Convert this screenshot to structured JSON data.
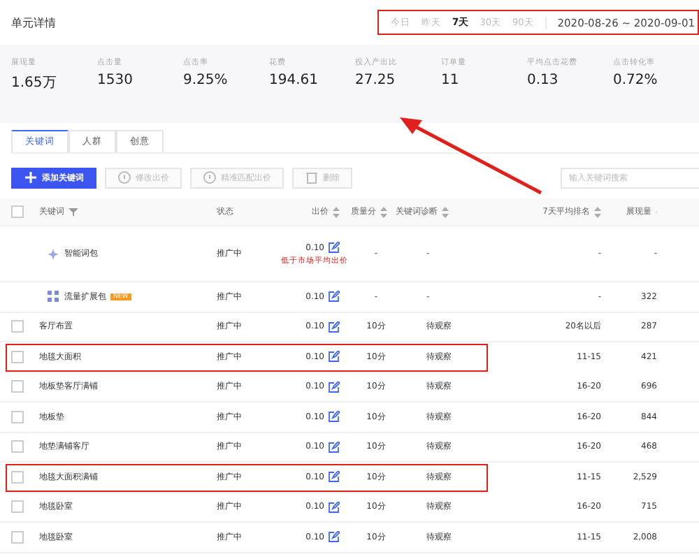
{
  "title": "单元详情",
  "date_filter": {
    "highlighted": true,
    "ranges": [
      {
        "label": "今日",
        "selected": false
      },
      {
        "label": "昨天",
        "selected": false
      },
      {
        "label": "7天",
        "selected": true
      },
      {
        "label": "30天",
        "selected": false
      },
      {
        "label": "90天",
        "selected": false
      }
    ],
    "date_range": "2020-08-26 ~ 2020-09-01"
  },
  "metrics": [
    {
      "label": "展现量",
      "value": "1.65万"
    },
    {
      "label": "点击量",
      "value": "1530"
    },
    {
      "label": "点击率",
      "value": "9.25%"
    },
    {
      "label": "花费",
      "value": "194.61"
    },
    {
      "label": "投入产出比",
      "value": "27.25"
    },
    {
      "label": "订单量",
      "value": "11"
    },
    {
      "label": "平均点击花费",
      "value": "0.13"
    },
    {
      "label": "点击转化率",
      "value": "0.72%"
    }
  ],
  "tabs": [
    {
      "label": "关键词",
      "selected": true
    },
    {
      "label": "人群",
      "selected": false
    },
    {
      "label": "创意",
      "selected": false
    }
  ],
  "toolbar": {
    "buttons": [
      {
        "label": "添加关键词",
        "kind": "add",
        "disabled": false
      },
      {
        "label": "修改出价",
        "kind": "edit",
        "disabled": true
      },
      {
        "label": "精准匹配出价",
        "kind": "edit",
        "disabled": true
      },
      {
        "label": "删除",
        "kind": "delete",
        "disabled": true
      }
    ],
    "search": {
      "placeholder": "输入关键词搜索"
    }
  },
  "table": {
    "select_all_checked": false,
    "columns": [
      "关键词",
      "状态",
      "出价",
      "质量分",
      "关键词诊断",
      "7天平均排名",
      "展现量"
    ],
    "rows": [
      {
        "kind": "package",
        "keyword": "智能词包",
        "status": "推广中",
        "bid": "0.10",
        "bid_note": "低于市场平均出价",
        "quality": "-",
        "diagnosis": "-",
        "rank": "-",
        "impressions": "-",
        "highlighted": false
      },
      {
        "kind": "package",
        "keyword": "流量扩展包",
        "badge": "NEW",
        "status": "推广中",
        "bid": "0.10",
        "quality": "-",
        "diagnosis": "-",
        "rank": "-",
        "impressions": "322",
        "highlighted": false
      },
      {
        "kind": "keyword",
        "checked": false,
        "keyword": "客厅布置",
        "status": "推广中",
        "bid": "0.10",
        "quality": "10分",
        "diagnosis": "待观察",
        "rank": "20名以后",
        "impressions": "287",
        "highlighted": false
      },
      {
        "kind": "keyword",
        "checked": false,
        "keyword": "地毯大面积",
        "status": "推广中",
        "bid": "0.10",
        "quality": "10分",
        "diagnosis": "待观察",
        "rank": "11-15",
        "impressions": "421",
        "highlighted": true
      },
      {
        "kind": "keyword",
        "checked": false,
        "keyword": "地板垫客厅满铺",
        "status": "推广中",
        "bid": "0.10",
        "quality": "10分",
        "diagnosis": "待观察",
        "rank": "16-20",
        "impressions": "696",
        "highlighted": false
      },
      {
        "kind": "keyword",
        "checked": false,
        "keyword": "地板垫",
        "status": "推广中",
        "bid": "0.10",
        "quality": "10分",
        "diagnosis": "待观察",
        "rank": "16-20",
        "impressions": "844",
        "highlighted": false
      },
      {
        "kind": "keyword",
        "checked": false,
        "keyword": "地垫满铺客厅",
        "status": "推广中",
        "bid": "0.10",
        "quality": "10分",
        "diagnosis": "待观察",
        "rank": "16-20",
        "impressions": "468",
        "highlighted": false
      },
      {
        "kind": "keyword",
        "checked": false,
        "keyword": "地毯大面积满铺",
        "status": "推广中",
        "bid": "0.10",
        "quality": "10分",
        "diagnosis": "待观察",
        "rank": "11-15",
        "impressions": "2,529",
        "highlighted": true
      },
      {
        "kind": "keyword",
        "checked": false,
        "keyword": "地毯卧室",
        "status": "推广中",
        "bid": "0.10",
        "quality": "10分",
        "diagnosis": "待观察",
        "rank": "16-20",
        "impressions": "715",
        "highlighted": false
      },
      {
        "kind": "keyword",
        "checked": false,
        "keyword": "地毯卧室",
        "status": "推广中",
        "bid": "0.10",
        "quality": "10分",
        "diagnosis": "待观察",
        "rank": "11-15",
        "impressions": "2,008",
        "highlighted": false
      }
    ]
  }
}
